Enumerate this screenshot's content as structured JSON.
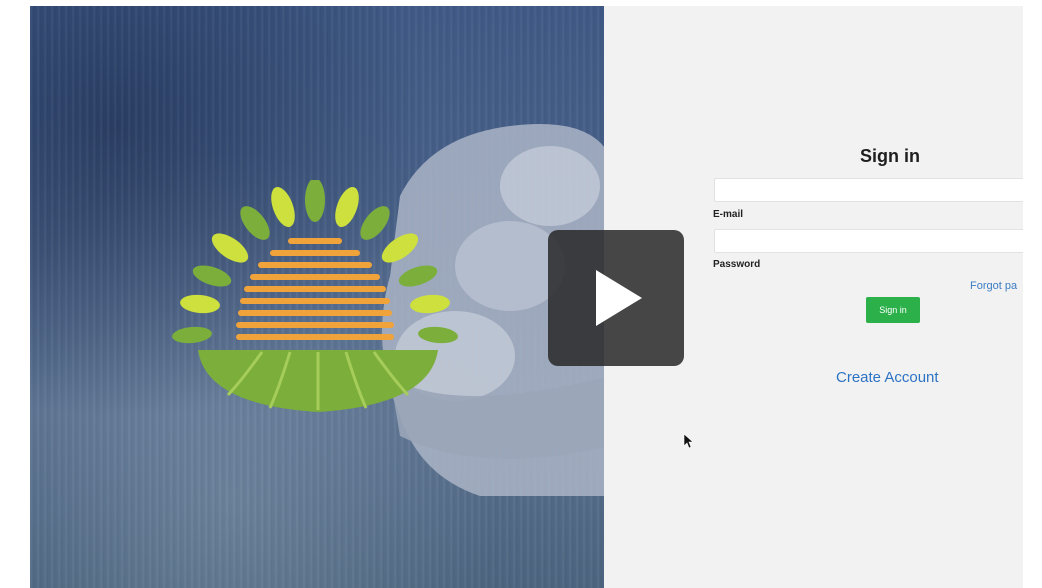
{
  "login": {
    "title": "Sign in",
    "email_label": "E-mail",
    "password_label": "Password",
    "forgot_label": "Forgot pa",
    "signin_button_label": "Sign in",
    "create_account_label": "Create Account"
  },
  "icons": {
    "play": "play-icon",
    "cursor": "cursor-icon",
    "logo": "sun-field-logo"
  },
  "colors": {
    "hero_blue": "#4a6288",
    "panel_bg": "#f2f2f2",
    "button_green": "#2bb04a",
    "link_blue": "#2d73c4",
    "logo_orange": "#f0a33a",
    "logo_green": "#7cae3c",
    "leaf_yellow": "#cde03d"
  }
}
